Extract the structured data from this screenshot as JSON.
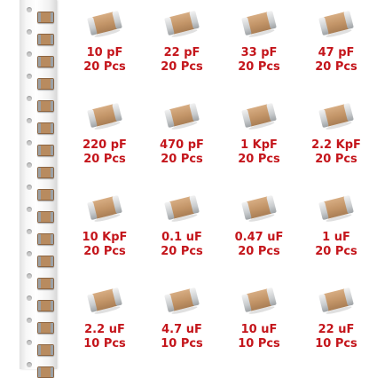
{
  "colors": {
    "label": "#c4151b",
    "chip_body": "#c29467",
    "terminal": "#c9ccce",
    "tape": "#f7f7f7"
  },
  "items": [
    {
      "value": "10 pF",
      "qty": "20 Pcs"
    },
    {
      "value": "22 pF",
      "qty": "20 Pcs"
    },
    {
      "value": "33 pF",
      "qty": "20 Pcs"
    },
    {
      "value": "47 pF",
      "qty": "20 Pcs"
    },
    {
      "value": "220 pF",
      "qty": "20 Pcs"
    },
    {
      "value": "470 pF",
      "qty": "20 Pcs"
    },
    {
      "value": "1 KpF",
      "qty": "20 Pcs"
    },
    {
      "value": "2.2 KpF",
      "qty": "20 Pcs"
    },
    {
      "value": "10 KpF",
      "qty": "20 Pcs"
    },
    {
      "value": "0.1 uF",
      "qty": "20 Pcs"
    },
    {
      "value": "0.47 uF",
      "qty": "20 Pcs"
    },
    {
      "value": "1 uF",
      "qty": "20 Pcs"
    },
    {
      "value": "2.2 uF",
      "qty": "10 Pcs"
    },
    {
      "value": "4.7 uF",
      "qty": "10 Pcs"
    },
    {
      "value": "10 uF",
      "qty": "10 Pcs"
    },
    {
      "value": "22 uF",
      "qty": "10 Pcs"
    }
  ]
}
